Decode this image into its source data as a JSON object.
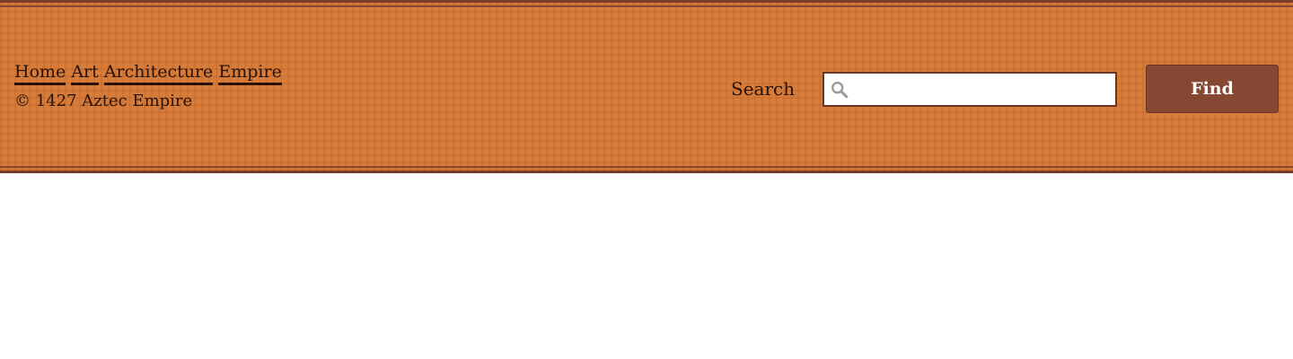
{
  "header": {
    "background_color": "#d87c3a",
    "border_color": "#7a3b28"
  },
  "nav": {
    "items": [
      {
        "label": "Home"
      },
      {
        "label": "Art"
      },
      {
        "label": "Architecture"
      },
      {
        "label": "Empire"
      }
    ]
  },
  "footer_text": {
    "copyright": "© 1427 Aztec Empire"
  },
  "search": {
    "label": "Search",
    "value": "",
    "placeholder": "",
    "icon": "search-icon",
    "button_label": "Find",
    "button_color": "#864733"
  }
}
